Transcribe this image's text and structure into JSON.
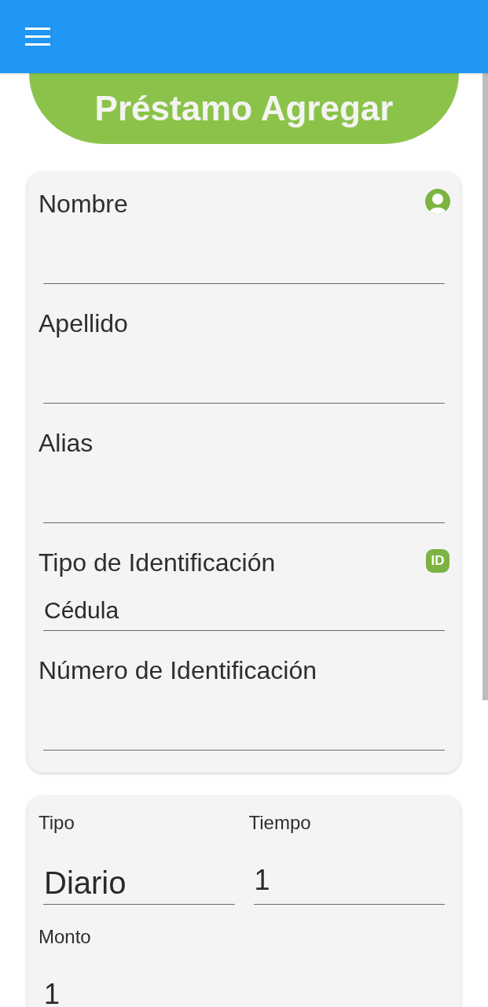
{
  "title": "Préstamo Agregar",
  "client_card": {
    "fields": [
      {
        "label": "Nombre",
        "kind": "text"
      },
      {
        "label": "Apellido",
        "kind": "text"
      },
      {
        "label": "Alias",
        "kind": "text"
      },
      {
        "label": "Tipo de Identificación",
        "kind": "select",
        "value": "Cédula",
        "badge": "ID"
      },
      {
        "label": "Número de Identificación",
        "kind": "text"
      }
    ]
  },
  "loan_card": {
    "fields": [
      {
        "label": "Tipo",
        "kind": "select",
        "value": "Diario"
      },
      {
        "label": "Tiempo",
        "kind": "text",
        "value": "1"
      },
      {
        "label": "Monto",
        "kind": "text",
        "value": "1"
      }
    ]
  }
}
